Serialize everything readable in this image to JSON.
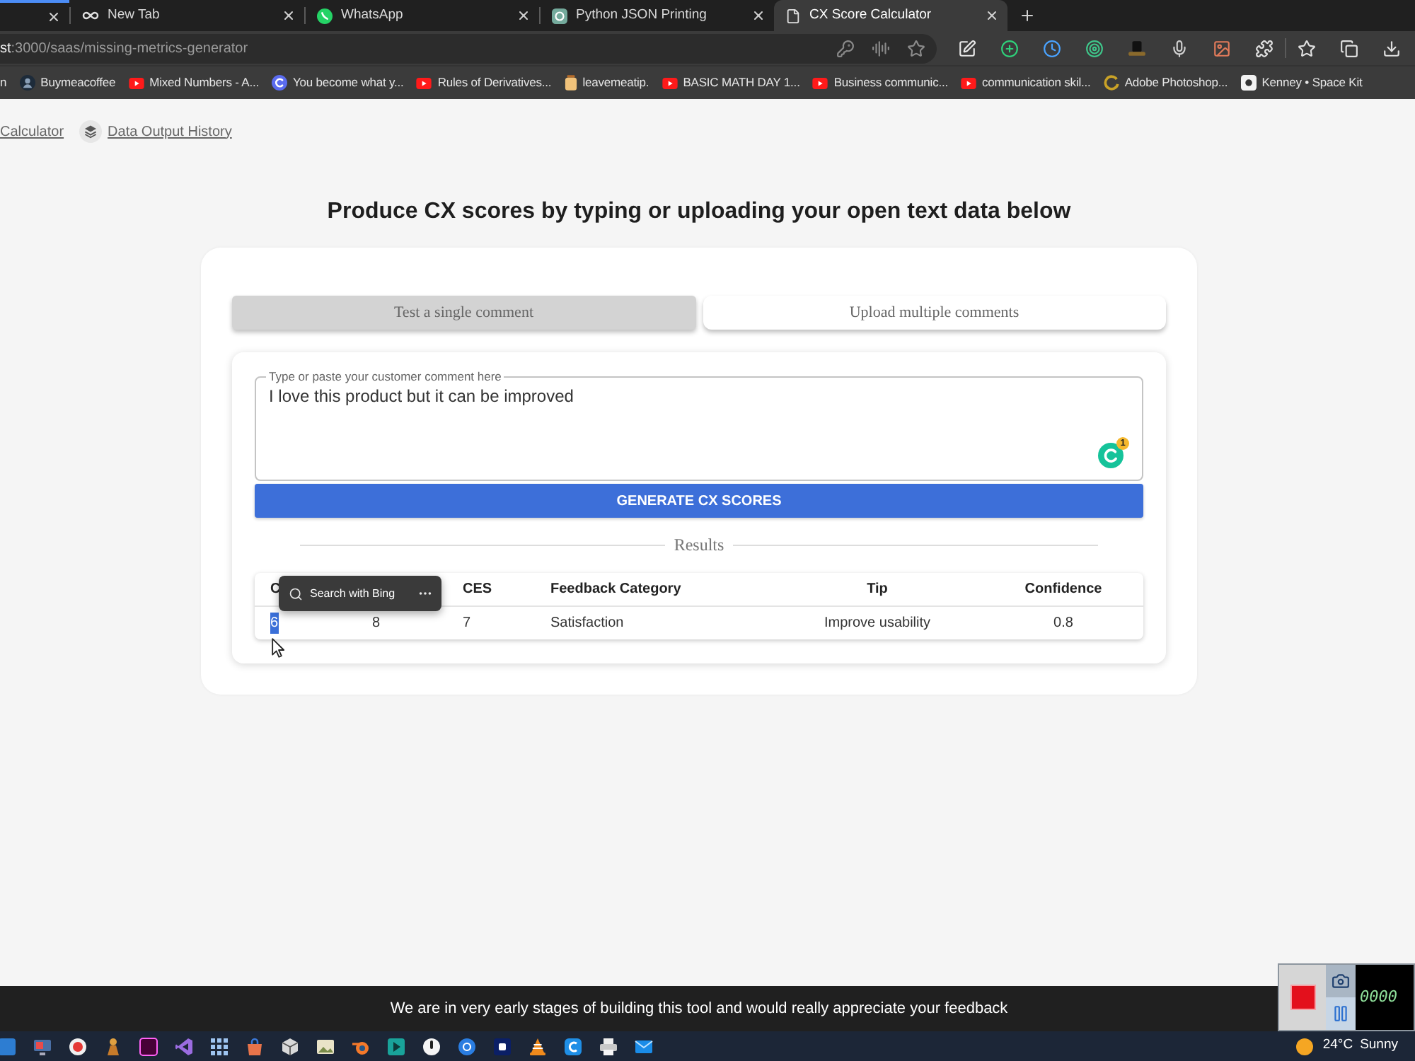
{
  "browser": {
    "tabs": [
      {
        "selected": false
      },
      {
        "title": "New Tab",
        "selected": false
      },
      {
        "title": "WhatsApp",
        "selected": false
      },
      {
        "title": "Python JSON Printing",
        "selected": false
      },
      {
        "title": "CX Score Calculator",
        "selected": true
      }
    ],
    "address_bar": {
      "host": "st",
      "path": ":3000/saas/missing-metrics-generator"
    },
    "bookmarks": [
      {
        "title": "n"
      },
      {
        "title": "Buymeacoffee"
      },
      {
        "title": "Mixed Numbers - A..."
      },
      {
        "title": "You become what y..."
      },
      {
        "title": "Rules of Derivatives..."
      },
      {
        "title": "leavemeatip."
      },
      {
        "title": "BASIC MATH DAY 1..."
      },
      {
        "title": "Business communic..."
      },
      {
        "title": "communication skil..."
      },
      {
        "title": "Adobe Photoshop..."
      },
      {
        "title": "Kenney • Space Kit"
      }
    ]
  },
  "page": {
    "nav_links": [
      "Calculator",
      "Data Output History"
    ],
    "heading": "Produce CX scores by typing or uploading your open text data below",
    "mode_tabs": [
      {
        "label": "Test a single comment",
        "selected": true
      },
      {
        "label": "Upload multiple comments",
        "selected": false
      }
    ],
    "comment_field": {
      "label": "Type or paste your customer comment here",
      "value": "I love this product but it can be improved",
      "assistant_badge": "1"
    },
    "generate_button": "GENERATE CX SCORES",
    "results_divider": "Results",
    "results_table": {
      "columns": [
        {
          "label": "C"
        },
        {},
        {
          "label": "CES"
        },
        {
          "label": "Feedback Category"
        },
        {
          "label": "Tip"
        },
        {
          "label": "Confidence"
        }
      ],
      "rows": [
        {
          "cells": [
            {
              "text": "6",
              "selected": true
            },
            {
              "text": "8",
              "selected": false
            },
            {
              "text": "7",
              "selected": false
            },
            {
              "text": "Satisfaction",
              "selected": false
            },
            {
              "text": "Improve usability",
              "selected": false
            },
            {
              "text": "0.8",
              "selected": false
            }
          ]
        }
      ]
    },
    "selection_popup": {
      "action": "Search with Bing"
    }
  },
  "feedback_banner": "We are in very early stages of building this tool and would really appreciate your feedback",
  "screen_recorder": {
    "timer": "0000"
  },
  "taskbar": {
    "weather": {
      "temperature": "24°C",
      "condition": "Sunny"
    }
  }
}
